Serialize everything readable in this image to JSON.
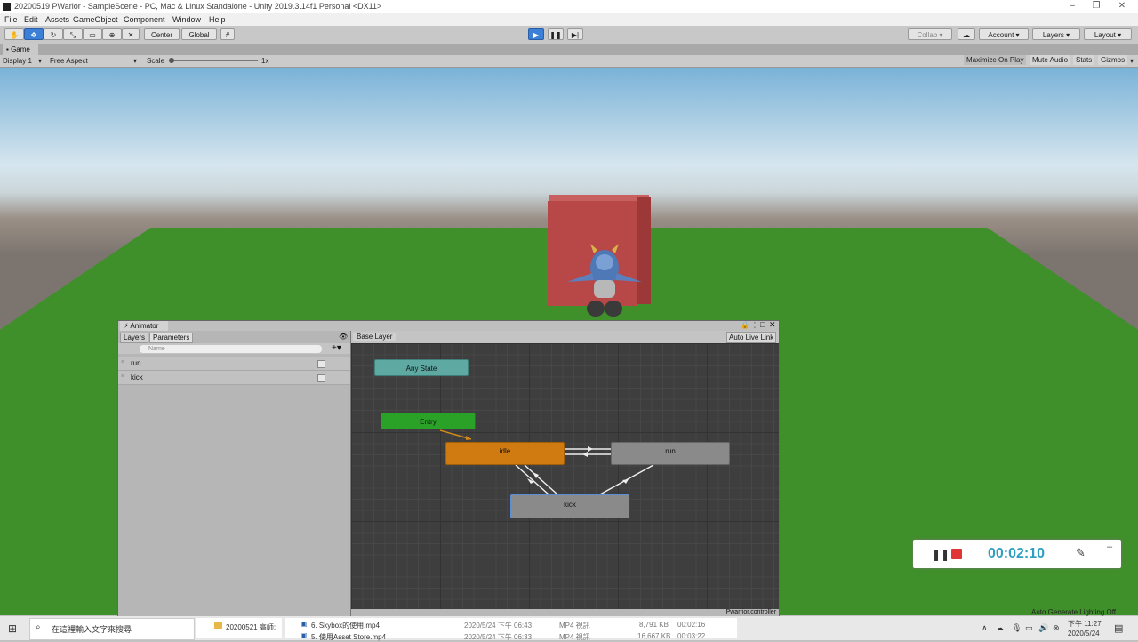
{
  "window": {
    "title": "20200519 PWarior - SampleScene - PC, Mac & Linux Standalone - Unity 2019.3.14f1 Personal <DX11>"
  },
  "menu": [
    "File",
    "Edit",
    "Assets",
    "GameObject",
    "Component",
    "Window",
    "Help"
  ],
  "toolbar": {
    "center": "Center",
    "global": "Global",
    "collab": "Collab",
    "account": "Account",
    "layers": "Layers",
    "layout": "Layout"
  },
  "game": {
    "tab": "Game",
    "display": "Display 1",
    "aspect": "Free Aspect",
    "scale_label": "Scale",
    "scale_value": "1x",
    "maximize": "Maximize On Play",
    "mute": "Mute Audio",
    "stats": "Stats",
    "gizmos": "Gizmos"
  },
  "animator": {
    "title": "Animator",
    "tabs": {
      "layers": "Layers",
      "parameters": "Parameters"
    },
    "search_placeholder": "Name",
    "params": [
      {
        "name": "run"
      },
      {
        "name": "kick"
      }
    ],
    "breadcrumb": "Base Layer",
    "auto_live": "Auto Live Link",
    "states": {
      "any": "Any State",
      "entry": "Entry",
      "idle": "idle",
      "run": "run",
      "kick": "kick"
    },
    "footer": "Pwarrior.controller"
  },
  "recorder": {
    "time": "00:02:10"
  },
  "taskbar": {
    "search": "在這裡輸入文字來搜尋",
    "folder": "20200521 高師:",
    "files": [
      {
        "name": "6. Skybox的使用.mp4",
        "date": "2020/5/24 下午 06:43",
        "type": "MP4 視訊",
        "size": "8,791 KB",
        "dur": "00:02:16"
      },
      {
        "name": "5. 使用Asset Store.mp4",
        "date": "2020/5/24 下午 06:33",
        "type": "MP4 視訊",
        "size": "16,667 KB",
        "dur": "00:03:22"
      }
    ],
    "lighting": "Auto Generate Lighting Off",
    "clock_time": "下午 11:27",
    "clock_date": "2020/5/24"
  },
  "colors": {
    "any_state": "#5fa9a3",
    "entry": "#2aa227",
    "idle": "#d07a12",
    "gray_state": "#8a8a8a",
    "record": "#e03535",
    "timer": "#2e9fc0"
  }
}
